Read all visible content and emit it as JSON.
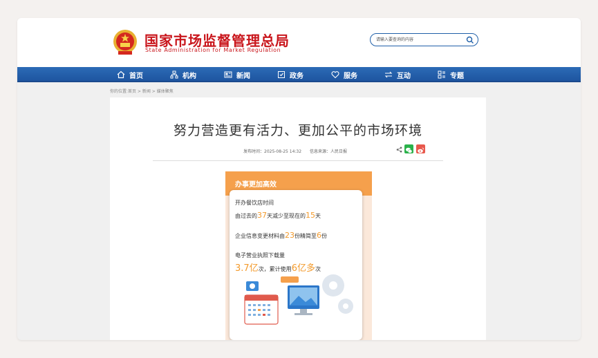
{
  "header": {
    "site_title": "国家市场监督管理总局",
    "site_subtitle": "State Administration for Market Regulation",
    "search_placeholder": "请输入要查询的内容"
  },
  "nav": {
    "items": [
      {
        "label": "首页",
        "icon": "home-icon"
      },
      {
        "label": "机构",
        "icon": "org-chart-icon"
      },
      {
        "label": "新闻",
        "icon": "news-icon"
      },
      {
        "label": "政务",
        "icon": "government-affairs-icon"
      },
      {
        "label": "服务",
        "icon": "heart-icon"
      },
      {
        "label": "互动",
        "icon": "exchange-arrows-icon"
      },
      {
        "label": "专题",
        "icon": "topics-grid-icon"
      }
    ]
  },
  "breadcrumb": "你的位置:首页 > 新闻 > 媒体聚焦",
  "article": {
    "title": "努力营造更有活力、更加公平的市场环境",
    "publish_time": "发布时间：2025-08-25 14:32",
    "source": "信息来源：人民日报"
  },
  "infographic": {
    "header": "办事更加高效",
    "items": [
      {
        "line1": "开办餐饮店时间",
        "line2_pre": "由过去的",
        "v1": "37",
        "line2_mid": "天减少至现在的",
        "v2": "15",
        "line2_post": "天"
      },
      {
        "pre": "企业信息变更材料由",
        "v1": "23",
        "mid": "份精简至",
        "v2": "6",
        "post": "份"
      },
      {
        "line1": "电子营业执照下载量",
        "v1": "3.7亿",
        "mid": "次，累计使用",
        "v2": "6亿多",
        "post": "次"
      }
    ]
  },
  "colors": {
    "brand_red": "#c9161c",
    "nav_blue": "#1e55a0",
    "accent_orange": "#f39a2b"
  }
}
